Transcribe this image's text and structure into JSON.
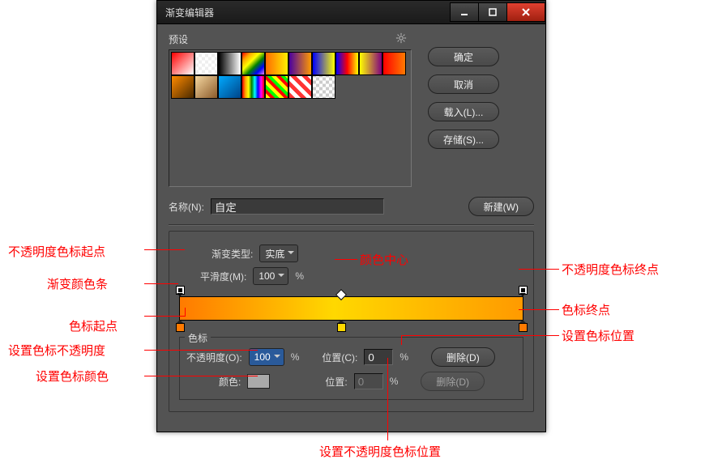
{
  "title": "渐变编辑器",
  "presets_label": "预设",
  "buttons": {
    "ok": "确定",
    "cancel": "取消",
    "load": "载入(L)...",
    "save": "存储(S)...",
    "new": "新建(W)",
    "delete": "删除(D)",
    "delete2": "删除(D)"
  },
  "name_label": "名称(N):",
  "name_value": "自定",
  "type_label": "渐变类型:",
  "type_value": "实底",
  "smooth_label": "平滑度(M):",
  "smooth_value": "100",
  "pct": "%",
  "stops_label": "色标",
  "opacity_label": "不透明度(O):",
  "opacity_value": "100",
  "loc_label": "位置(C):",
  "loc_value": "0",
  "color_label": "颜色:",
  "loc2_label": "位置:",
  "loc2_value": "0",
  "annotations": {
    "a1": "不透明度色标起点",
    "a2": "渐变颜色条",
    "a3": "色标起点",
    "a4": "设置色标不透明度",
    "a5": "设置色标颜色",
    "a6": "颜色中心",
    "a7": "不透明度色标终点",
    "a8": "色标终点",
    "a9": "设置色标位置",
    "a10": "设置不透明度色标位置"
  },
  "chart_data": {
    "type": "gradient",
    "stops": [
      {
        "pos": 0,
        "color": "#ff7a00"
      },
      {
        "pos": 50,
        "color": "#ffd800"
      },
      {
        "pos": 100,
        "color": "#ff9a00"
      }
    ],
    "opacity_stops": [
      {
        "pos": 0,
        "opacity": 100
      },
      {
        "pos": 100,
        "opacity": 100
      }
    ]
  }
}
